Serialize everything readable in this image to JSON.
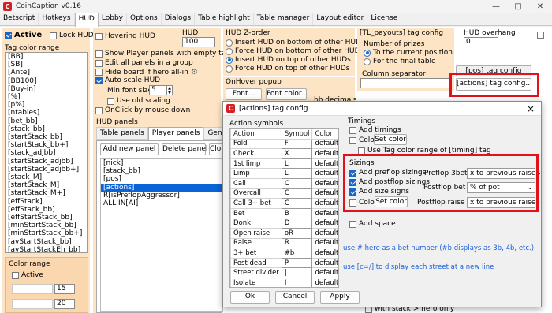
{
  "window": {
    "title": "CoinCaption v0.16",
    "app_icon": "C"
  },
  "main_tabs": [
    "Betscript",
    "Hotkeys",
    "HUD",
    "Lobby",
    "Options",
    "Dialogs",
    "Table highlight",
    "Table manager",
    "Layout editor",
    "License"
  ],
  "left": {
    "active_label": "Active",
    "lock_label": "Lock HUD",
    "tag_color_range": "Tag color range",
    "tags": [
      "[BB]",
      "[SB]",
      "[Ante]",
      "[BB100]",
      "[Buy-in]",
      "[%]",
      "[p%]",
      "[ntables]",
      "[bet_bb]",
      "[stack_bb]",
      "[startStack_bb]",
      "[startStack_bb+]",
      "[stack_adjbb]",
      "[startStack_adjbb]",
      "[startStack_adjbb+]",
      "[stack_M]",
      "[startStack_M]",
      "[startStack_M+]",
      "[effStack]",
      "[effStack_bb]",
      "[effStartStack_bb]",
      "[minStartStack_bb]",
      "[minStartStack_bb+]",
      "[avStartStack_bb]",
      "[avStartStackEh_bb]"
    ],
    "color_range": "Color range",
    "color_active": "Active",
    "val1": "15",
    "val2": "20"
  },
  "col2": {
    "hovering": "Hovering HUD",
    "hud_opacity": "HUD opacity",
    "opacity_value": "100",
    "show_empty": "Show Player panels with empty tags",
    "edit_all": "Edit all panels in a group",
    "hide_board": "Hide board if hero all-in",
    "auto_scale": "Auto scale HUD",
    "min_font": "Min font size",
    "min_font_val": "5",
    "old_scaling": "Use old scaling",
    "onclick": "OnClick by mouse down",
    "hud_panels": "HUD panels",
    "panel_tabs": [
      "Table panels",
      "Player panels",
      "General HUD"
    ],
    "add_panel": "Add new panel",
    "delete_panel": "Delete panel",
    "clone": "Clone",
    "panel_lines": [
      "[nick]",
      "[stack_bb]",
      "[pos]",
      "[actions]",
      "R[isPreflopAggressor]",
      "ALL IN[AI]"
    ],
    "selected_line": "[actions]"
  },
  "col3": {
    "zorder_title": "HUD Z-order",
    "zorder_opts": [
      "Insert HUD on bottom of other HUDs",
      "Force HUD on bottom of other HUDs",
      "Insert HUD on top of other HUDs",
      "Force HUD on top of other HUDs"
    ],
    "zorder_selected": 2,
    "onhover": "OnHover popup",
    "font_btn": "Font...",
    "font_color_btn": "Font color...",
    "bb_decimals": "bb decimals"
  },
  "col4": {
    "payouts_title": "[TL_payouts] tag config",
    "num_prizes": "Number of prizes",
    "prize_opts": [
      "To the current position",
      "For the final table"
    ],
    "prize_selected": 0,
    "col_sep": "Column separator",
    "col_sep_val": ":",
    "pos_cfg": "[pos] tag config",
    "actions_cfg": "[actions] tag config..."
  },
  "col5": {
    "overhang": "HUD overhang",
    "overhang_val": "0"
  },
  "dialog": {
    "title": "[actions] tag config",
    "close": "×",
    "action_symbols": "Action symbols",
    "headers": [
      "Action",
      "Symbol",
      "Color"
    ],
    "rows": [
      [
        "Fold",
        "F",
        "default"
      ],
      [
        "Check",
        "X",
        "default"
      ],
      [
        "1st limp",
        "L",
        "default"
      ],
      [
        "Limp",
        "L",
        "default"
      ],
      [
        "Call",
        "C",
        "default"
      ],
      [
        "Overcall",
        "C",
        "default"
      ],
      [
        "Call 3+ bet",
        "C",
        "default"
      ],
      [
        "Bet",
        "B",
        "default"
      ],
      [
        "Donk",
        "D",
        "default"
      ],
      [
        "Open raise",
        "oR",
        "default"
      ],
      [
        "Raise",
        "R",
        "default"
      ],
      [
        "3+ bet",
        "#b",
        "default"
      ],
      [
        "Post dead",
        "P",
        "default"
      ],
      [
        "Street divider",
        "|",
        "default"
      ],
      [
        "Isolate",
        "I",
        "default"
      ]
    ],
    "timings_title": "Timings",
    "add_timings": "Add timings",
    "color": "Color",
    "set_color": "Set color",
    "use_tag_color": "Use Tag color range of [timing] tag",
    "sizings_title": "Sizings",
    "add_preflop": "Add preflop sizings",
    "add_postflop": "Add postflop sizings",
    "add_size": "Add size signs",
    "preflop_3bet": "Preflop 3bet as",
    "preflop_3bet_val": "x to previous raise",
    "postflop_bet": "Postflop bet as",
    "postflop_bet_val": "% of pot",
    "postflop_raise": "Postflop raise as",
    "postflop_raise_val": "x to previous raise",
    "add_space": "Add space",
    "hint1": "use # here as a bet number (#b displays as 3b, 4b, etc.)",
    "hint2": "use [c=/] to display each street at a new line",
    "ok": "Ok",
    "cancel": "Cancel",
    "apply": "Apply"
  },
  "bottom": {
    "stack_hero": "with stack > hero only"
  }
}
